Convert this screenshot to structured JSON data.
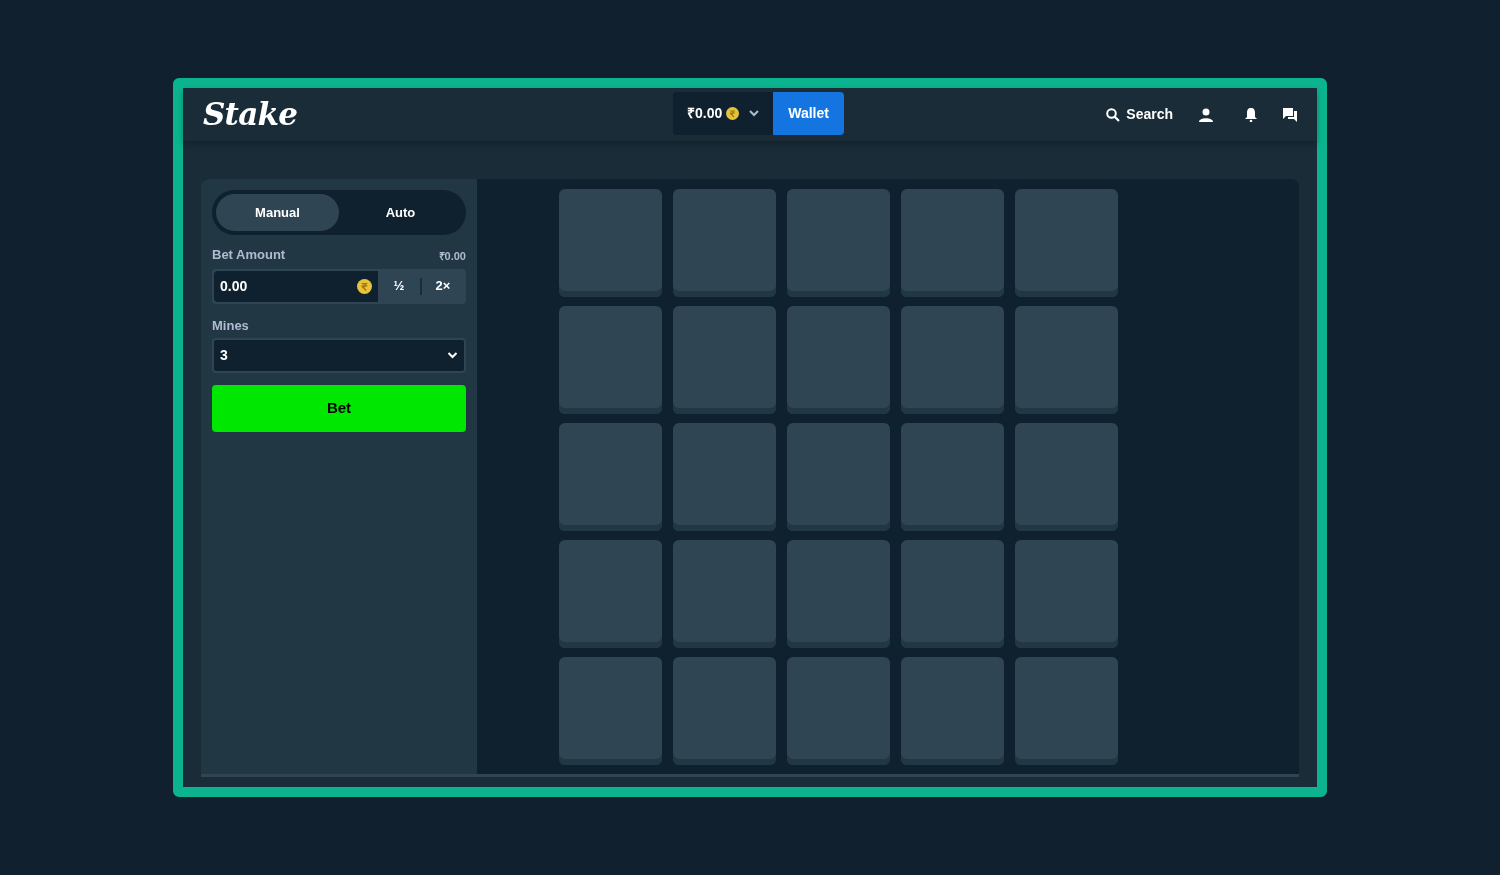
{
  "header": {
    "logo": "Stake",
    "balance": "₹0.00",
    "wallet_button": "Wallet",
    "search": "Search"
  },
  "sidebar": {
    "tabs": [
      {
        "label": "Manual",
        "selected": true
      },
      {
        "label": "Auto",
        "selected": false
      }
    ],
    "bet_amount": {
      "label": "Bet Amount",
      "balance": "₹0.00",
      "value": "0.00",
      "half": "½",
      "double": "2×"
    },
    "mines": {
      "label": "Mines",
      "value": "3"
    },
    "bet_button": "Bet"
  },
  "tiles": [
    {
      "revealed": false
    },
    {
      "revealed": false
    },
    {
      "revealed": false
    },
    {
      "revealed": false
    },
    {
      "revealed": false
    },
    {
      "revealed": false
    },
    {
      "revealed": false
    },
    {
      "revealed": false
    },
    {
      "revealed": false
    },
    {
      "revealed": false
    },
    {
      "revealed": false
    },
    {
      "revealed": false
    },
    {
      "revealed": false
    },
    {
      "revealed": false
    },
    {
      "revealed": false
    },
    {
      "revealed": false
    },
    {
      "revealed": false
    },
    {
      "revealed": false
    },
    {
      "revealed": false
    },
    {
      "revealed": false
    },
    {
      "revealed": false
    },
    {
      "revealed": false
    },
    {
      "revealed": false
    },
    {
      "revealed": false
    },
    {
      "revealed": false
    }
  ]
}
